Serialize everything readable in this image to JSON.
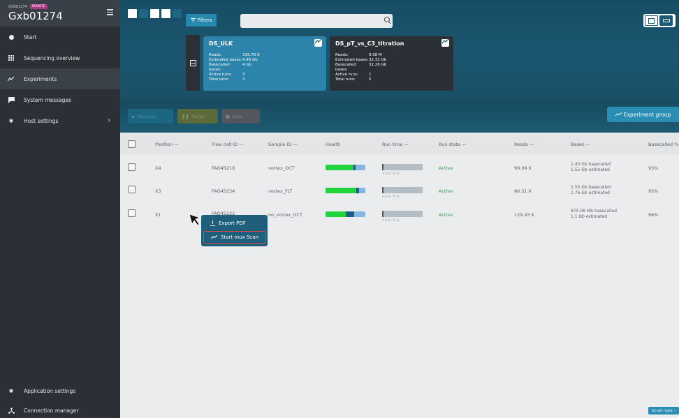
{
  "sidebar": {
    "device_small": "GXB01274",
    "remote_badge": "REMOTE",
    "title": "Gxb01274",
    "items": [
      {
        "label": "Start",
        "icon": "play-circle-icon"
      },
      {
        "label": "Sequencing overview",
        "icon": "grid-icon"
      },
      {
        "label": "Experiments",
        "icon": "chart-line-icon"
      },
      {
        "label": "System messages",
        "icon": "message-icon"
      },
      {
        "label": "Host settings",
        "icon": "gear-icon"
      }
    ],
    "bottom": [
      {
        "label": "Application settings",
        "icon": "gear-icon"
      },
      {
        "label": "Connection manager",
        "icon": "network-icon"
      }
    ]
  },
  "header": {
    "filters_label": "Filters",
    "search_placeholder": "",
    "cards": [
      {
        "title": "DS_ULK",
        "rows": [
          {
            "k": "Reads:",
            "v": "316.78 K"
          },
          {
            "k": "Estimated bases:",
            "v": "4.46 Gb"
          },
          {
            "k": "Basecalled bases:",
            "v": "4 Gb"
          },
          {
            "k": "Active runs:",
            "v": "3"
          },
          {
            "k": "Total runs:",
            "v": "3"
          }
        ]
      },
      {
        "title": "DS_pT_vs_C3_titration",
        "rows": [
          {
            "k": "Reads:",
            "v": "8.08 M"
          },
          {
            "k": "Estimated bases:",
            "v": "32.32 Gb"
          },
          {
            "k": "Basecalled bases:",
            "v": "32.26 Gb"
          },
          {
            "k": "Active runs:",
            "v": "1"
          },
          {
            "k": "Total runs:",
            "v": "5"
          }
        ]
      }
    ],
    "resume_label": "Resume",
    "pause_label": "Pause",
    "stop_label": "Stop",
    "experiment_group_label": "Experiment group"
  },
  "table": {
    "columns": [
      "Position —",
      "Flow cell ID —",
      "Sample ID —",
      "Health",
      "Run time —",
      "Run state —",
      "Reads —",
      "Bases —",
      "Basecalled %"
    ],
    "rows": [
      {
        "position": "X4",
        "flow_cell": "FAO45218",
        "sample": "vortex_OCT",
        "health_green": 0.7,
        "health_blue": 0.06,
        "run_time": "3.5 H / 72 H",
        "state": "Active",
        "reads": "99.09 K",
        "bases1": "1.43 Gb basecalled",
        "bases2": "1.55 Gb estimated",
        "basecalled": "95%"
      },
      {
        "position": "X3",
        "flow_cell": "FAO45234",
        "sample": "vortex_FLT",
        "health_green": 0.77,
        "health_blue": 0.08,
        "run_time": "3.6 H / 72 H",
        "state": "Active",
        "reads": "86.31 K",
        "bases1": "1.55 Gb basecalled",
        "bases2": "1.76 Gb estimated",
        "basecalled": "95%"
      },
      {
        "position": "X1",
        "flow_cell": "FAO45222",
        "sample": "no_vortex_OCT",
        "health_green": 0.5,
        "health_blue": 0.22,
        "run_time": "3.6 H / 72 H",
        "state": "Active",
        "reads": "129.43 K",
        "bases1": "975.06 Mb basecalled",
        "bases2": "1.1 Gb estimated",
        "basecalled": "96%"
      }
    ]
  },
  "context_menu": {
    "export_label": "Export PDF",
    "mux_label": "Start mux Scan"
  },
  "scroll_right_label": "Scroll right"
}
